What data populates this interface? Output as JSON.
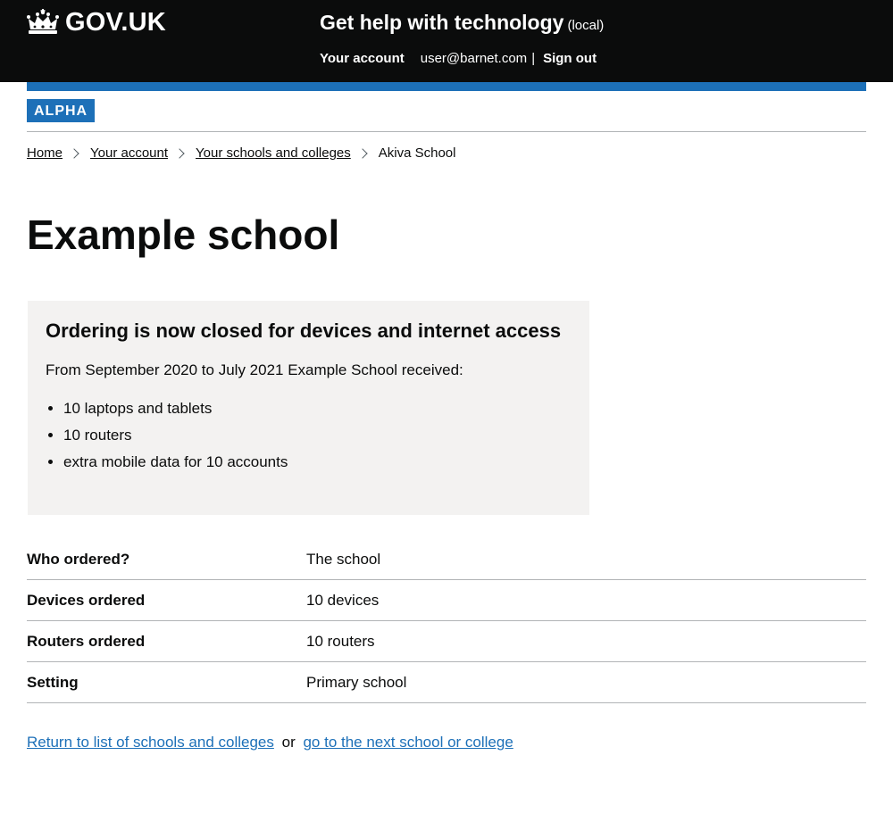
{
  "header": {
    "logo_text": "GOV.UK",
    "logo_icon": "crown-icon",
    "service_name": "Get help with technology",
    "environment": "(local)",
    "nav": {
      "account_label": "Your account",
      "email": "user@barnet.com",
      "separator": "|",
      "sign_out_label": "Sign out"
    }
  },
  "phase_banner": {
    "tag": "ALPHA"
  },
  "breadcrumbs": {
    "items": [
      "Home",
      "Your account",
      "Your schools and colleges"
    ],
    "current": "Akiva School"
  },
  "page": {
    "title": "Example school"
  },
  "panel": {
    "heading": "Ordering is now closed for devices and internet access",
    "intro": "From September 2020 to July 2021 Example School received:",
    "items": [
      "10 laptops and tablets",
      "10 routers",
      "extra mobile data for 10 accounts"
    ]
  },
  "summary": {
    "rows": [
      {
        "key": "Who ordered?",
        "value": "The school"
      },
      {
        "key": "Devices ordered",
        "value": "10 devices"
      },
      {
        "key": "Routers ordered",
        "value": "10 routers"
      },
      {
        "key": "Setting",
        "value": "Primary school"
      }
    ]
  },
  "footer_links": {
    "return_label": "Return to list of schools and colleges",
    "or_text": "or",
    "next_label": "go to the next school or college"
  },
  "colors": {
    "header_bg": "#0b0c0c",
    "brand_blue": "#1d70b8",
    "panel_bg": "#f3f2f1",
    "border": "#b1b4b6"
  }
}
